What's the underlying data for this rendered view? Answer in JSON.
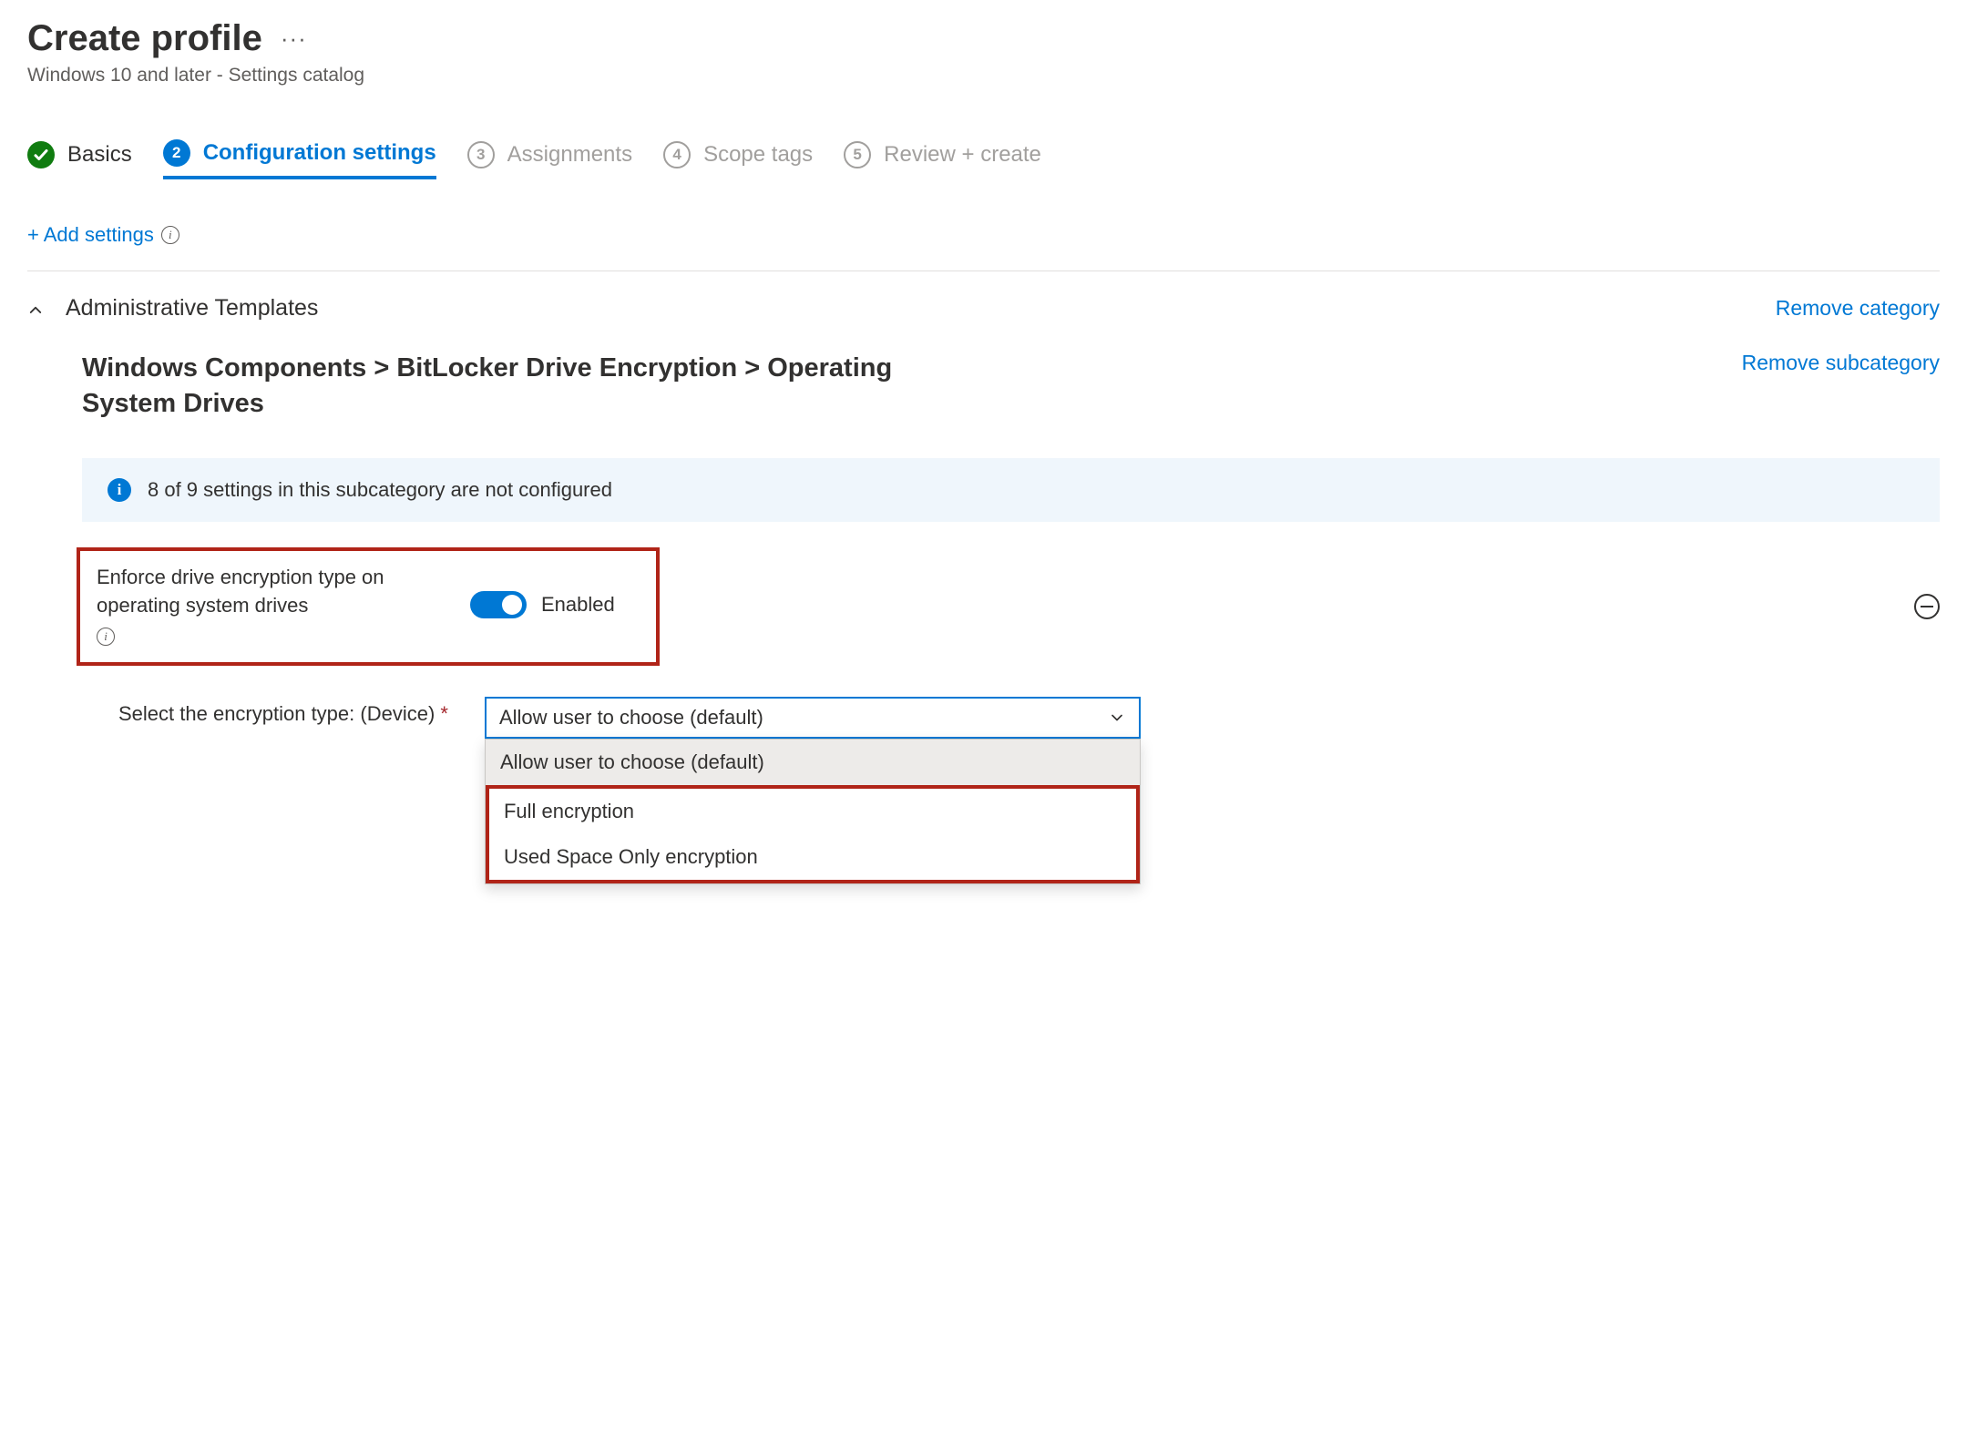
{
  "header": {
    "title": "Create profile",
    "subtitle": "Windows 10 and later - Settings catalog"
  },
  "stepper": {
    "steps": [
      {
        "num": "",
        "label": "Basics",
        "state": "done"
      },
      {
        "num": "2",
        "label": "Configuration settings",
        "state": "current"
      },
      {
        "num": "3",
        "label": "Assignments",
        "state": "pending"
      },
      {
        "num": "4",
        "label": "Scope tags",
        "state": "pending"
      },
      {
        "num": "5",
        "label": "Review + create",
        "state": "pending"
      }
    ]
  },
  "actions": {
    "add_settings": "+ Add settings",
    "remove_category": "Remove category",
    "remove_subcategory": "Remove subcategory"
  },
  "category": {
    "title": "Administrative Templates",
    "subcategory_title": "Windows Components > BitLocker Drive Encryption > Operating System Drives",
    "info_banner": "8 of 9 settings in this subcategory are not configured"
  },
  "setting": {
    "label": "Enforce drive encryption type on operating system drives",
    "toggle_state": "Enabled"
  },
  "field": {
    "label": "Select the encryption type: (Device)",
    "required_marker": "*",
    "selected_value": "Allow user to choose (default)",
    "options": [
      "Allow user to choose (default)",
      "Full encryption",
      "Used Space Only encryption"
    ]
  }
}
